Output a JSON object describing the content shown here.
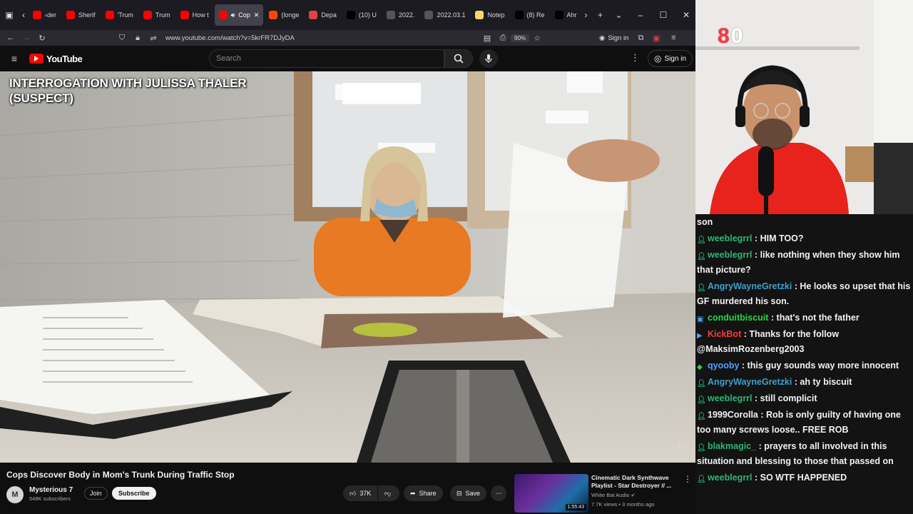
{
  "browser": {
    "tabs": [
      {
        "label": "‹der",
        "color": "#ff0000"
      },
      {
        "label": "Sherif",
        "color": "#ff0000"
      },
      {
        "label": "'Trum",
        "color": "#ff0000"
      },
      {
        "label": "Trum",
        "color": "#ff0000"
      },
      {
        "label": "How t",
        "color": "#ff0000"
      },
      {
        "label": "Cop",
        "color": "#ff0000",
        "active": true
      },
      {
        "label": "(longe",
        "color": "#ff4500"
      },
      {
        "label": "Depa",
        "color": "#d44"
      },
      {
        "label": "(10) U",
        "color": "#000"
      },
      {
        "label": "2022.",
        "color": "#555"
      },
      {
        "label": "2022.03.1",
        "color": "#555"
      },
      {
        "label": "Notep",
        "color": "#f5d76e"
      },
      {
        "label": "(8) Re",
        "color": "#000"
      },
      {
        "label": "Ahr",
        "color": "#000"
      }
    ],
    "url": "www.youtube.com/watch?v=5krFR7DJyDA",
    "zoom": "90%",
    "signin": "Sign in"
  },
  "youtube": {
    "logo": "YouTube",
    "search_placeholder": "Search",
    "signin": "Sign in"
  },
  "video": {
    "overlay_title": "INTERROGATION WITH JULISSA THALER (SUSPECT)",
    "watermark": "M7",
    "title": "Cops Discover Body in Mom's Trunk During Traffic Stop",
    "channel": "Mysterious 7",
    "channel_initial": "M",
    "subscribers": "548K subscribers",
    "join": "Join",
    "subscribe": "Subscribe",
    "likes": "37K",
    "share": "Share",
    "save": "Save"
  },
  "recommended": {
    "title": "Cinematic Dark Synthwave Playlist - Star Destroyer // ...",
    "channel": "White Bat Audio",
    "meta": "7.7K views • 3 months ago",
    "duration": "1:55:43"
  },
  "stream": {
    "viewer_count": "0"
  },
  "chat": [
    {
      "user": "",
      "text": "son",
      "color": "#f2f2f2",
      "badge": ""
    },
    {
      "user": "weeblegrrl",
      "text": " : HIM TOO?",
      "color": "#2bb673",
      "badge": "person"
    },
    {
      "user": "weeblegrrl",
      "text": " : like nothing when they show him that picture?",
      "color": "#2bb673",
      "badge": "person"
    },
    {
      "user": "AngryWayneGretzki",
      "text": " : He looks so upset that his GF murdered his son.",
      "color": "#3fa0c8",
      "badge": "person2"
    },
    {
      "user": "conduitbiscuit",
      "text": " : that's not the father",
      "color": "#2bd646",
      "badge": "tv"
    },
    {
      "user": "KickBot",
      "text": " : Thanks for the follow @MaksimRozenberg2003",
      "color": "#ff3b3b",
      "badge": "bot"
    },
    {
      "user": "qyooby",
      "text": " : this guy sounds way more innocent",
      "color": "#4aa3ff",
      "badge": "gem"
    },
    {
      "user": "AngryWayneGretzki",
      "text": " : ah ty biscuit",
      "color": "#3fa0c8",
      "badge": "person2"
    },
    {
      "user": "weeblegrrl",
      "text": " : still complicit",
      "color": "#2bb673",
      "badge": "person"
    },
    {
      "user": "1999Corolla",
      "text": " : Rob is only guilty of having one too many screws loose.. FREE ROB",
      "color": "#f2f2f2",
      "badge": "person"
    },
    {
      "user": "blakmagic_",
      "text": " : prayers to all involved in this situation and blessing to those that passed on",
      "color": "#2bb673",
      "badge": "person2"
    },
    {
      "user": "weeblegrrl",
      "text": " : SO WTF HAPPENED",
      "color": "#2bb673",
      "badge": "person"
    }
  ]
}
